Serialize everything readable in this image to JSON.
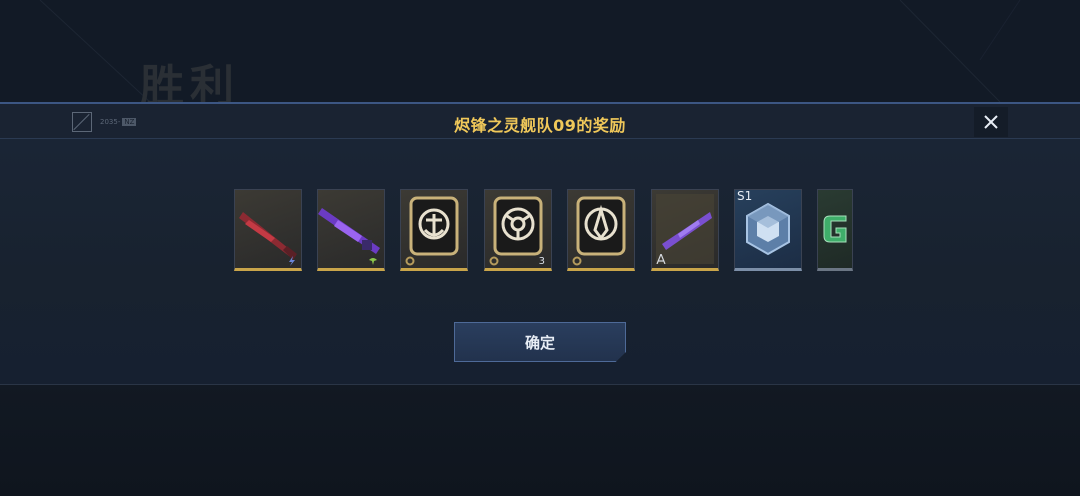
{
  "background": {
    "title_dim": "",
    "title_main": "胜利"
  },
  "dialog": {
    "logo_text": "2035-",
    "logo_tag": "NZ",
    "title": "烬锋之灵舰队09的奖励",
    "close_icon": "close-icon",
    "confirm_label": "确定"
  },
  "rewards": [
    {
      "name": "red-rifle",
      "icon": "lightning-icon"
    },
    {
      "name": "purple-rifle",
      "icon": "bird-icon"
    },
    {
      "name": "anchor-emblem",
      "icon": "gear-icon"
    },
    {
      "name": "circle-emblem",
      "icon": "gear-icon",
      "count": "3"
    },
    {
      "name": "blade-emblem",
      "icon": "gear-icon"
    },
    {
      "name": "blueprint-rifle",
      "icon": "compass-icon"
    },
    {
      "name": "s1-crate",
      "label": "S1"
    },
    {
      "name": "green-g-card"
    }
  ],
  "colors": {
    "accent_gold": "#f0c85a",
    "panel_border": "#3c5683",
    "button": "#2a3e5e"
  }
}
